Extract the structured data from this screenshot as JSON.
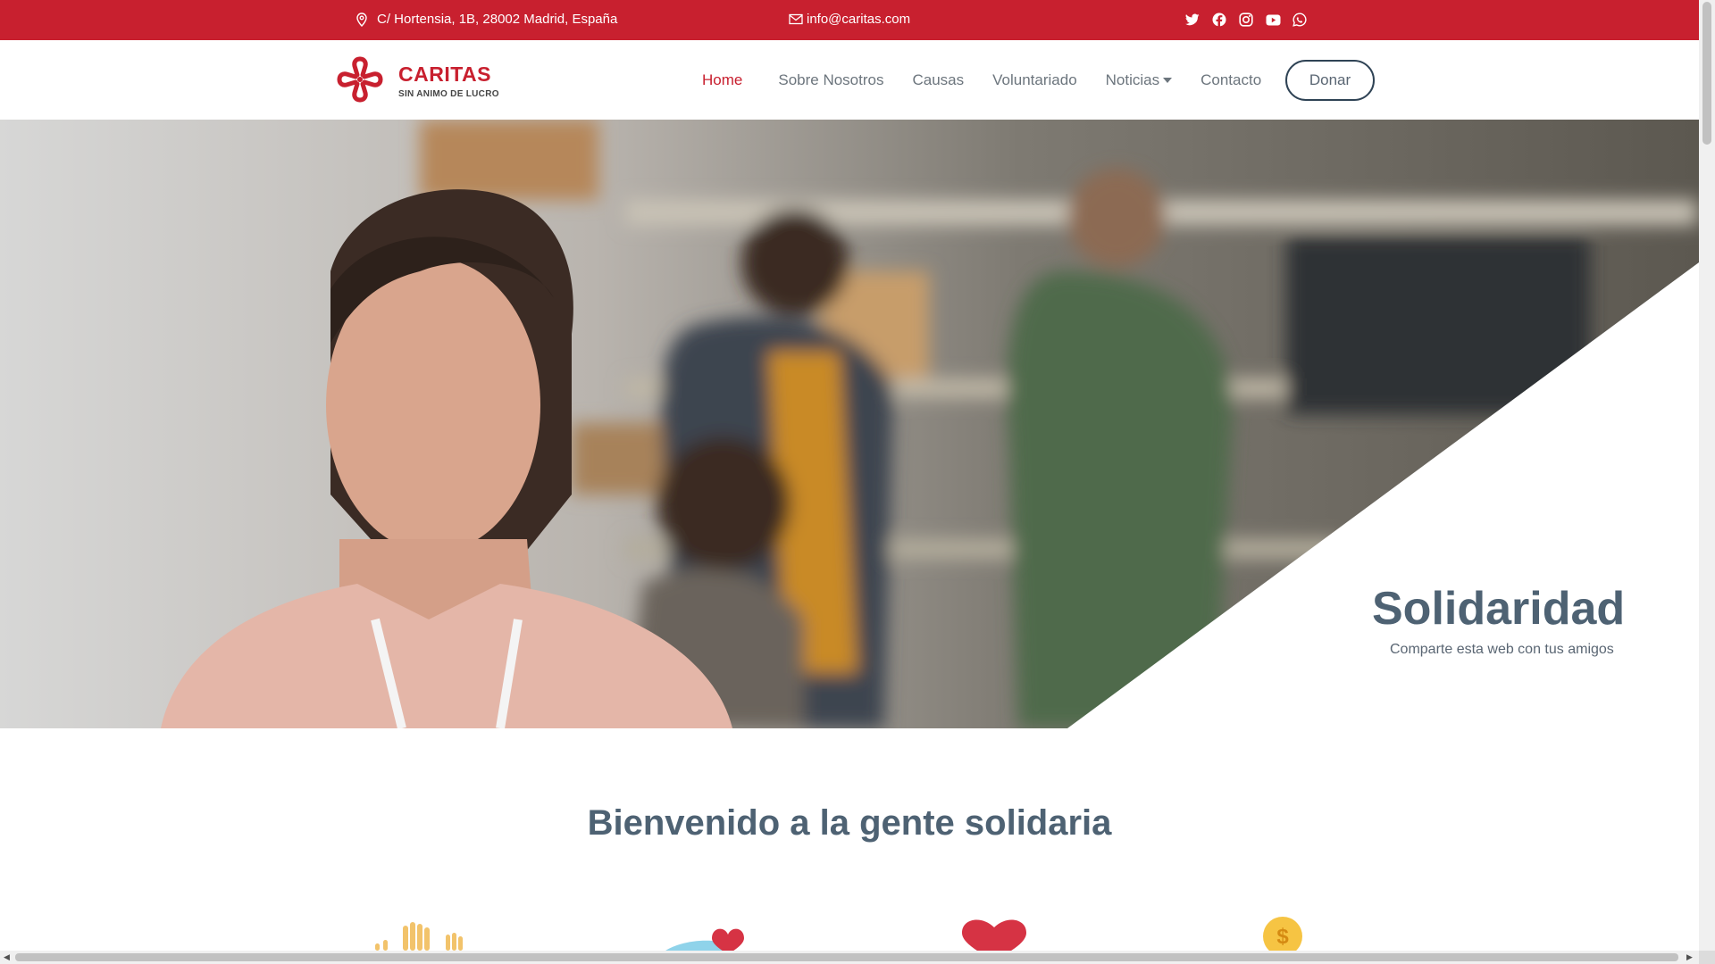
{
  "topbar": {
    "address": "C/ Hortensia, 1B, 28002 Madrid, España",
    "email": "info@caritas.com",
    "socials": [
      "twitter-icon",
      "facebook-icon",
      "instagram-icon",
      "youtube-icon",
      "whatsapp-icon"
    ],
    "color": "#c8202f"
  },
  "header": {
    "logo_name": "CARITAS",
    "logo_sub": "SIN ANIMO DE LUCRO",
    "nav": [
      "Home",
      "Sobre Nosotros",
      "Causas",
      "Voluntariado",
      "Noticias",
      "Contacto"
    ],
    "active_nav": "Home",
    "donate_label": "Donar"
  },
  "hero": {
    "title": "Solidaridad",
    "subtitle": "Comparte esta web con tus amigos"
  },
  "welcome": {
    "title": "Bienvenido a la gente solidaria",
    "feature_icons": [
      "hands-icon",
      "heart-hand-icon",
      "heart-icon",
      "coin-icon"
    ]
  },
  "colors": {
    "brand_red": "#c8202f",
    "heading": "#4e6273"
  }
}
